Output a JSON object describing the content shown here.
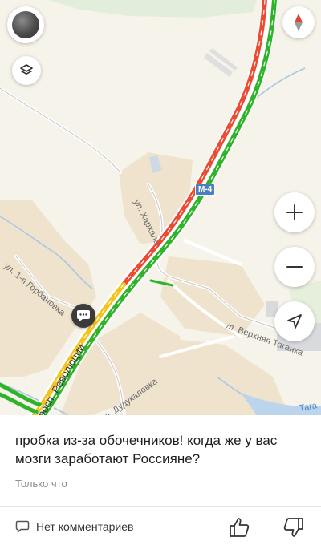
{
  "map": {
    "highway_shield": "M-4",
    "streets": {
      "harkhaly": "ул. Хархалы",
      "gorbanovka": "ул. 1-я Горбановка",
      "revolutsii": "просп. Революции",
      "verkhnyaya_taganka": "ул. Верхняя Таганка",
      "dudykalovka": "ул. Дудукаловка",
      "taga_partial": "Тага"
    },
    "controls": {
      "avatar_icon": "user-avatar-icon",
      "layers_icon": "layers-icon",
      "compass_icon": "compass-icon",
      "zoom_in_icon": "plus-icon",
      "zoom_out_icon": "minus-icon",
      "locate_icon": "navigation-arrow-icon",
      "comment_pin_icon": "chat-bubble-icon"
    },
    "colors": {
      "traffic_jam": "#ee4a32",
      "traffic_free": "#2fb32a",
      "traffic_slow": "#f4c21a",
      "compass_north": "#e24335"
    }
  },
  "comment": {
    "text": "пробка из-за обочечников! когда же у вас мозги заработают Россияне?",
    "time": "Только что",
    "replies_label": "Нет комментариев"
  }
}
